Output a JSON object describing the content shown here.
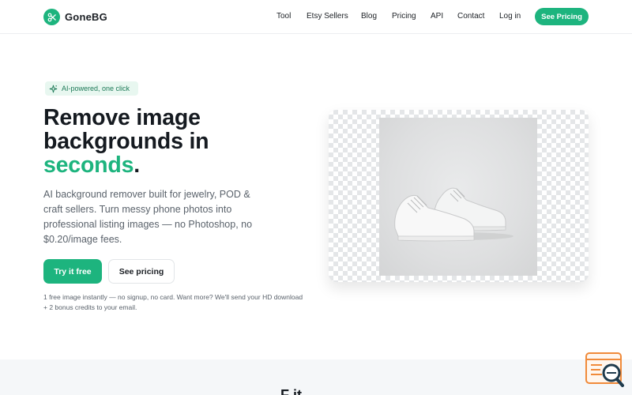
{
  "brand": {
    "name": "GoneBG",
    "accent": "#1db47e"
  },
  "nav": {
    "links": [
      "Tool",
      "Etsy Sellers",
      "Blog",
      "Pricing",
      "API",
      "Contact",
      "Log in"
    ],
    "cta": "See Pricing"
  },
  "hero": {
    "badge": "AI-powered, one click",
    "title_line1": "Remove image",
    "title_line2": "backgrounds in",
    "title_accent": "seconds",
    "title_period": ".",
    "subtitle": "AI background remover built for jewelry, POD & craft sellers. Turn messy phone photos into professional listing images — no Photoshop, no $0.20/image fees.",
    "primary_button": "Try it free",
    "secondary_button": "See pricing",
    "note": "1 free image instantly — no signup, no card. Want more? We'll send your HD download + 2 bonus credits to your email."
  },
  "preview": {
    "icon": "sneaker-product-photo"
  },
  "next_section": {
    "heading_partial": "F     it"
  },
  "widget": {
    "icon": "chat-search-icon"
  }
}
